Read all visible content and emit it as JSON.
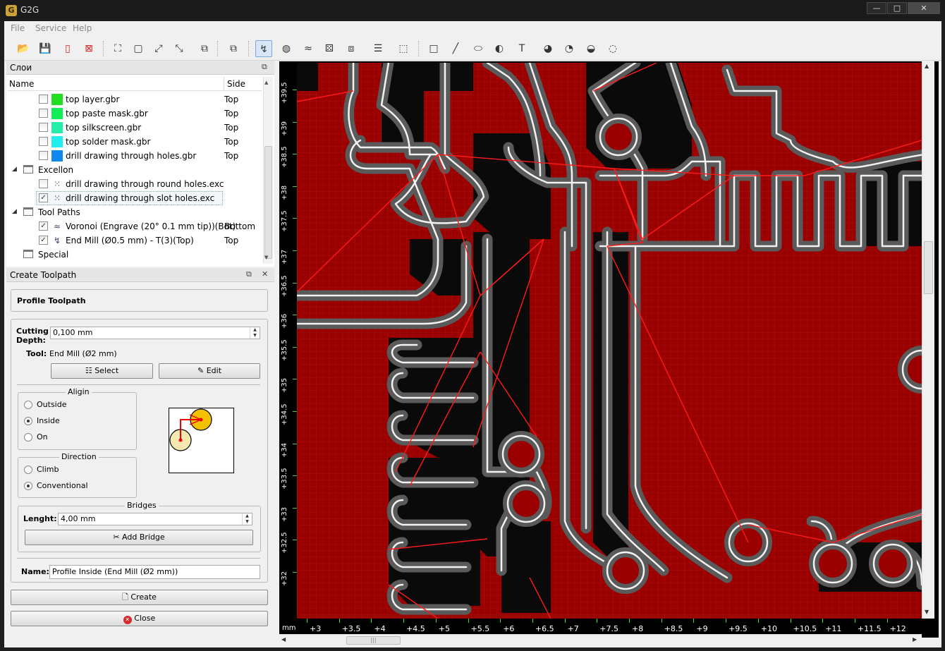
{
  "window": {
    "title": "G2G",
    "buttons": [
      "—",
      "□",
      "✕"
    ]
  },
  "menu": [
    "File",
    "Service",
    "Help"
  ],
  "layers_panel": {
    "title": "Слои",
    "columns": {
      "name": "Name",
      "side": "Side"
    },
    "rows": [
      {
        "label": "top layer.gbr",
        "side": "Top",
        "checked": false,
        "color": "#22dd22"
      },
      {
        "label": "top paste mask.gbr",
        "side": "Top",
        "checked": false,
        "color": "#11ee55"
      },
      {
        "label": "top silkscreen.gbr",
        "side": "Top",
        "checked": false,
        "color": "#22eeaa"
      },
      {
        "label": "top solder mask.gbr",
        "side": "Top",
        "checked": false,
        "color": "#22eeee"
      },
      {
        "label": "drill drawing through holes.gbr",
        "side": "Top",
        "checked": false,
        "color": "#1188ee"
      }
    ],
    "excellon": {
      "label": "Excellon",
      "rows": [
        {
          "label": "drill drawing through round holes.exc",
          "checked": false
        },
        {
          "label": "drill drawing through slot holes.exc",
          "checked": true
        }
      ]
    },
    "tool_paths": {
      "label": "Tool Paths",
      "rows": [
        {
          "label": "Voronoi (Engrave (20° 0.1 mm tip))(Bot)",
          "side": "Bottom",
          "checked": true
        },
        {
          "label": "End Mill (Ø0.5 mm) - T(3)(Top)",
          "side": "Top",
          "checked": true
        }
      ]
    },
    "special": {
      "label": "Special"
    }
  },
  "create_toolpath": {
    "title": "Create Toolpath",
    "heading": "Profile Toolpath",
    "cutting_depth_label": "Cutting\nDepth:",
    "cutting_depth_value": "0,100 mm",
    "tool_label": "Tool:",
    "tool_value": "End Mill (Ø2 mm)",
    "select_label": "Select",
    "edit_label": "Edit",
    "align": {
      "title": "Aligin",
      "options": [
        "Outside",
        "Inside",
        "On"
      ],
      "selected": "Inside"
    },
    "direction": {
      "title": "Direction",
      "options": [
        "Climb",
        "Conventional"
      ],
      "selected": "Conventional"
    },
    "bridges": {
      "title": "Bridges",
      "length_label": "Lenght:",
      "length_value": "4,00 mm",
      "add_label": "Add Bridge"
    },
    "name_label": "Name:",
    "name_value": "Profile Inside (End Mill (Ø2 mm))",
    "create_label": "Create",
    "close_label": "Close"
  },
  "canvas": {
    "unit": "mm",
    "x_ticks": [
      "+3",
      "+3.5",
      "+4",
      "+4.5",
      "+5",
      "+5.5",
      "+6",
      "+6.5",
      "+7",
      "+7.5",
      "+8",
      "+8.5",
      "+9",
      "+9.5",
      "+10",
      "+10.5",
      "+11",
      "+11.5",
      "+12"
    ],
    "y_ticks": [
      "+39.5",
      "+39",
      "+38.5",
      "+38",
      "+37.5",
      "+37",
      "+36.5",
      "+36",
      "+35.5",
      "+35",
      "+34.5",
      "+34",
      "+33.5",
      "+33",
      "+32.5",
      "+32"
    ],
    "colors": {
      "board": "#9a0000",
      "copper": "#0a0a0a",
      "path_outer": "#555555",
      "path_inner": "#ffffff",
      "toolpath_line": "#ff1a1a"
    }
  }
}
